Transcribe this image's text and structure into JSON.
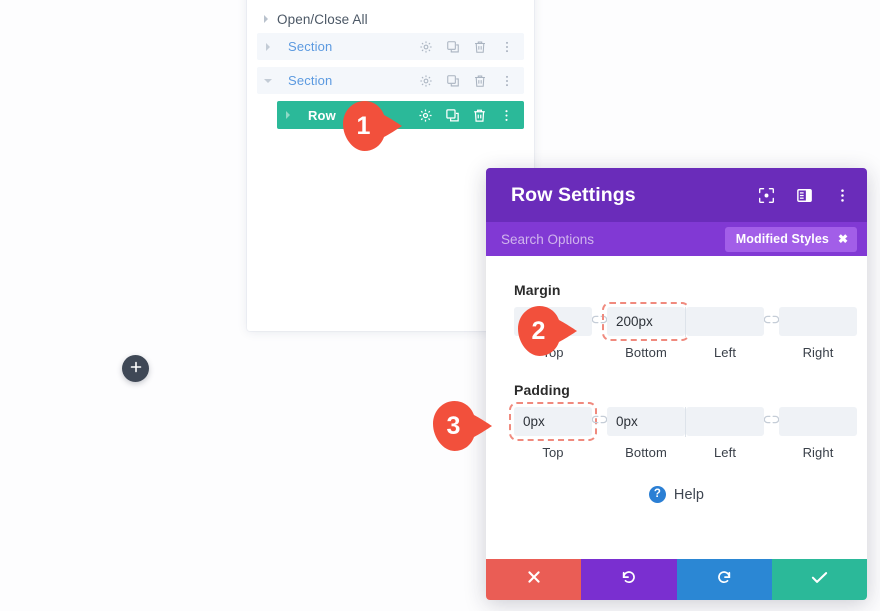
{
  "layers_panel": {
    "open_close_all": "Open/Close All",
    "rows": [
      {
        "label": "Section",
        "type": "section",
        "expanded": false,
        "actions": [
          "gear-icon",
          "duplicate-icon",
          "trash-icon",
          "more-vertical-icon"
        ]
      },
      {
        "label": "Section",
        "type": "section",
        "expanded": true,
        "actions": [
          "gear-icon",
          "duplicate-icon",
          "trash-icon",
          "more-vertical-icon"
        ]
      },
      {
        "label": "Row",
        "type": "row",
        "expanded": false,
        "actions": [
          "gear-icon",
          "duplicate-icon",
          "trash-icon",
          "more-vertical-icon"
        ]
      }
    ]
  },
  "add_button": {
    "icon": "plus-icon",
    "label": "+"
  },
  "row_settings": {
    "title": "Row Settings",
    "header_icons": [
      "focus-mode-icon",
      "panel-layout-icon",
      "more-vertical-icon"
    ],
    "search": {
      "placeholder": "Search Options",
      "value": ""
    },
    "modified_badge": {
      "label": "Modified Styles",
      "close_icon": "close-icon"
    },
    "margin": {
      "label": "Margin",
      "fields": [
        {
          "caption": "Top",
          "value": "",
          "highlighted": false
        },
        {
          "caption": "Bottom",
          "value": "200px",
          "highlighted": true
        },
        {
          "caption": "Left",
          "value": "",
          "highlighted": false
        },
        {
          "caption": "Right",
          "value": "",
          "highlighted": false
        }
      ],
      "link_icon": "broken-link-icon"
    },
    "padding": {
      "label": "Padding",
      "fields": [
        {
          "caption": "Top",
          "value": "0px",
          "highlighted": true
        },
        {
          "caption": "Bottom",
          "value": "0px",
          "highlighted": false
        },
        {
          "caption": "Left",
          "value": "",
          "highlighted": false
        },
        {
          "caption": "Right",
          "value": "",
          "highlighted": false
        }
      ],
      "link_icon": "broken-link-icon"
    },
    "help": {
      "label": "Help",
      "icon": "question-circle-icon"
    },
    "footer_buttons": [
      {
        "name": "cancel",
        "icon": "close-icon",
        "color": "#ea5d55"
      },
      {
        "name": "undo",
        "icon": "undo-icon",
        "color": "#7a2fd0"
      },
      {
        "name": "redo",
        "icon": "redo-icon",
        "color": "#2b87d4"
      },
      {
        "name": "save",
        "icon": "check-icon",
        "color": "#2bb999"
      }
    ]
  },
  "callouts": [
    {
      "number": "1"
    },
    {
      "number": "2"
    },
    {
      "number": "3"
    }
  ],
  "colors": {
    "header_purple": "#6a2cba",
    "search_purple": "#8139d4",
    "badge_purple": "#a25ee8",
    "row_green": "#2bb999",
    "section_link_blue": "#5c9ae0",
    "marker_red": "#f2503c",
    "highlight_dashed": "#f08a7e"
  }
}
